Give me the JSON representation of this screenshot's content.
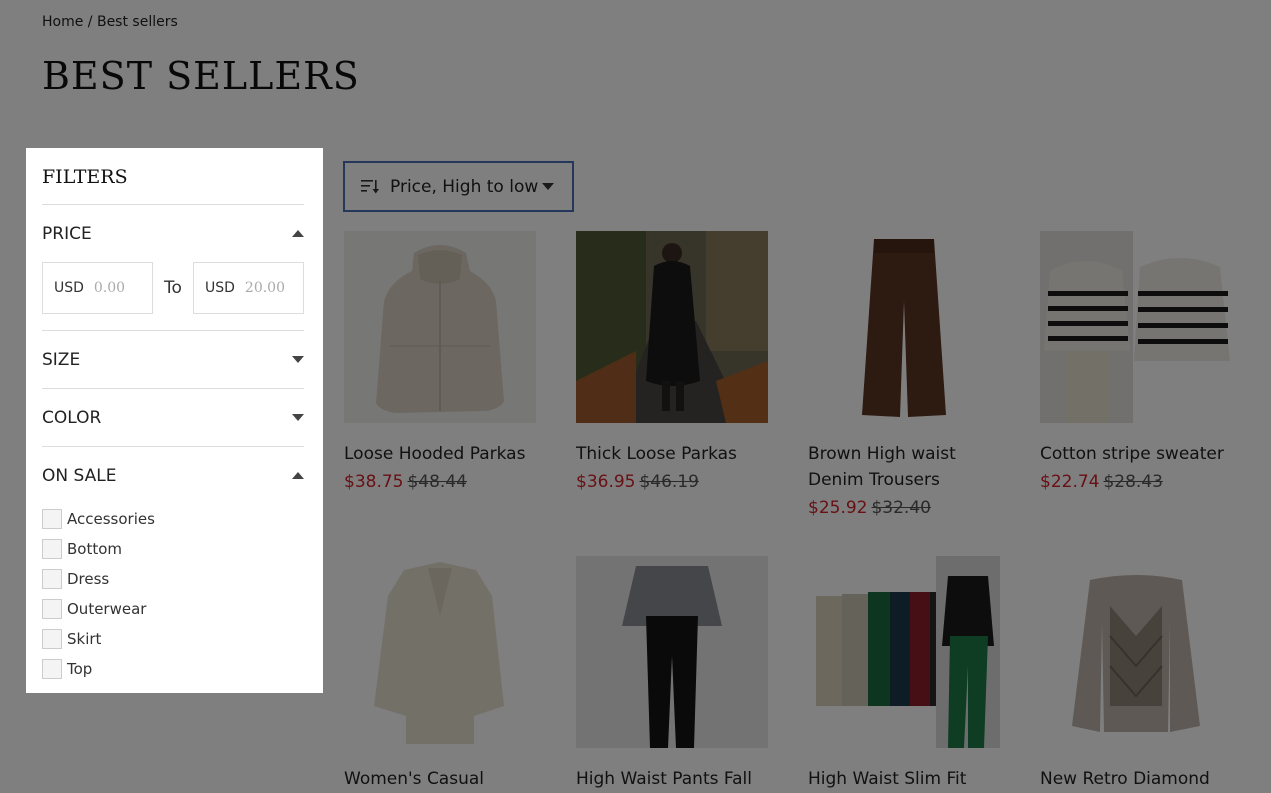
{
  "breadcrumb": {
    "home": "Home",
    "separator": " / ",
    "current": "Best sellers"
  },
  "page_title": "BEST SELLERS",
  "sort": {
    "label": "Price, High to low",
    "icon": "sort-icon"
  },
  "products": [
    {
      "name": "Loose Hooded Parkas",
      "sale": "$38.75",
      "old": "$48.44",
      "image": "beige hooded parka coat"
    },
    {
      "name": "Thick Loose Parkas",
      "sale": "$36.95",
      "old": "$46.19",
      "image": "black puffer coat on leaf path"
    },
    {
      "name": "Brown High waist Denim Trousers",
      "sale": "$25.92",
      "old": "$32.40",
      "image": "brown wide-leg trousers"
    },
    {
      "name": "Cotton stripe sweater",
      "sale": "$22.74",
      "old": "$28.43",
      "image": "striped cream sweater"
    },
    {
      "name": "Women's Casual",
      "sale": "",
      "old": "",
      "image": "cream blazer"
    },
    {
      "name": "High Waist Pants Fall",
      "sale": "",
      "old": "",
      "image": "black leather pants"
    },
    {
      "name": "High Waist Slim Fit",
      "sale": "",
      "old": "",
      "image": "colored trousers set"
    },
    {
      "name": "New Retro Diamond",
      "sale": "",
      "old": "",
      "image": "argyle sweater"
    }
  ],
  "filters": {
    "title": "FILTERS",
    "price": {
      "label": "PRICE",
      "currency_from": "USD",
      "placeholder_from": "0.00",
      "to_label": "To",
      "currency_to": "USD",
      "placeholder_to": "20.00"
    },
    "size": {
      "label": "SIZE"
    },
    "color": {
      "label": "COLOR"
    },
    "on_sale": {
      "label": "ON SALE",
      "options": [
        "Accessories",
        "Bottom",
        "Dress",
        "Outerwear",
        "Skirt",
        "Top"
      ]
    }
  },
  "colors": {
    "sale_price": "#d0232b",
    "sort_border": "#4a6fb5",
    "overlay": "rgba(0,0,0,0.5)"
  }
}
